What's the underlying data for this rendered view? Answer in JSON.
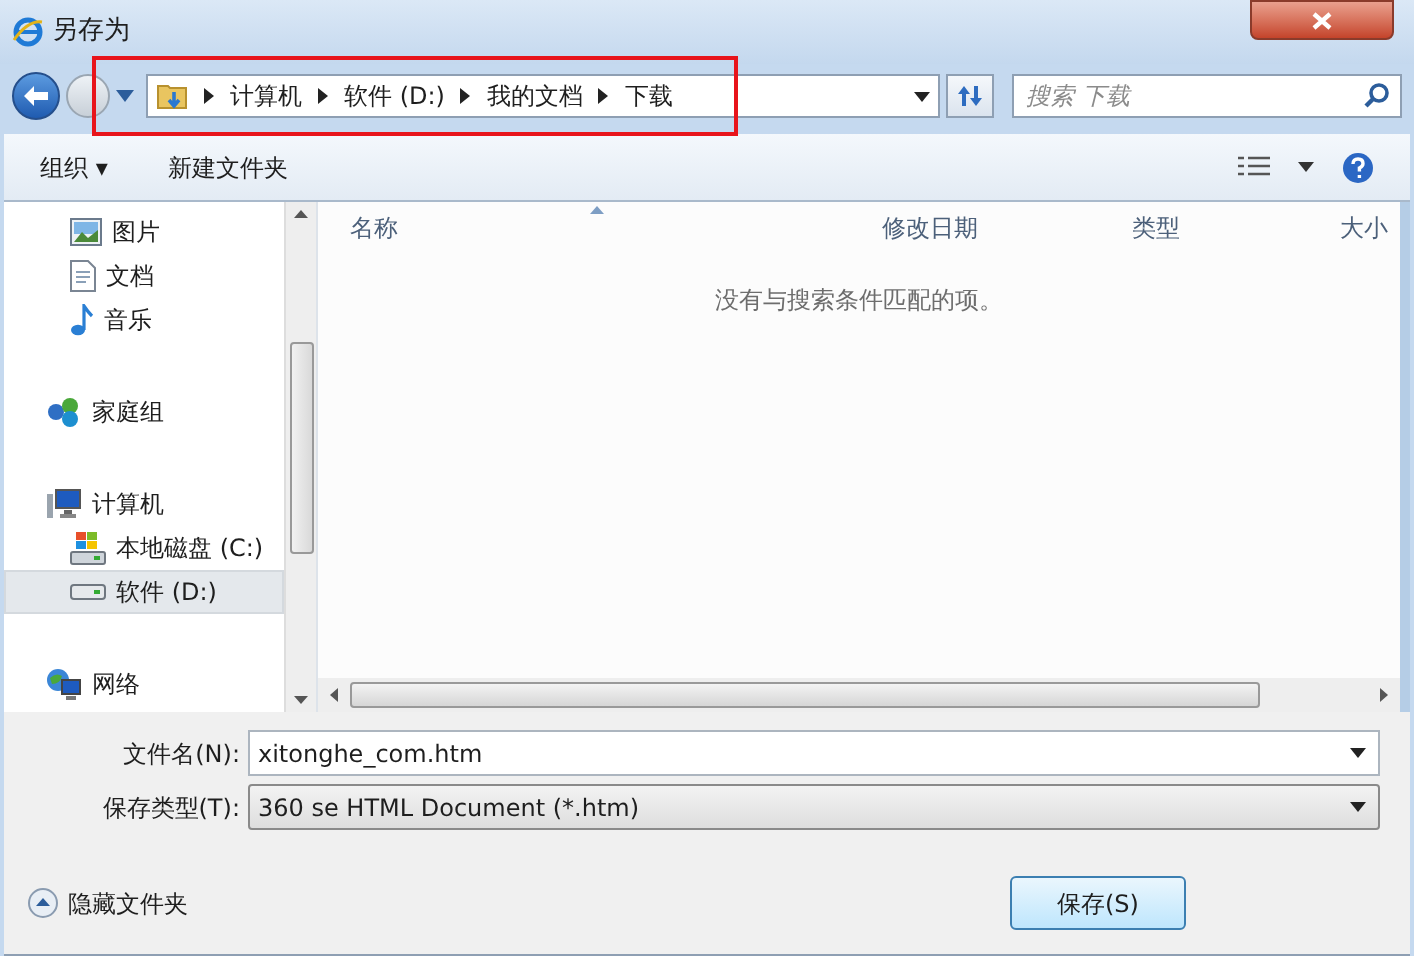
{
  "window": {
    "title": "另存为"
  },
  "breadcrumb": [
    "计算机",
    "软件 (D:)",
    "我的文档",
    "下载"
  ],
  "search": {
    "placeholder": "搜索 下载"
  },
  "toolbar": {
    "organize": "组织 ▾",
    "new_folder": "新建文件夹"
  },
  "sidebar": {
    "items": [
      {
        "label": "图片",
        "kind": "pictures",
        "group": false,
        "selected": false
      },
      {
        "label": "文档",
        "kind": "documents",
        "group": false,
        "selected": false
      },
      {
        "label": "音乐",
        "kind": "music",
        "group": false,
        "selected": false
      },
      {
        "label": "家庭组",
        "kind": "homegroup",
        "group": true,
        "selected": false
      },
      {
        "label": "计算机",
        "kind": "computer",
        "group": true,
        "selected": false
      },
      {
        "label": "本地磁盘 (C:)",
        "kind": "systemdrive",
        "group": false,
        "selected": false
      },
      {
        "label": "软件 (D:)",
        "kind": "drive",
        "group": false,
        "selected": true
      },
      {
        "label": "网络",
        "kind": "network",
        "group": true,
        "selected": false
      }
    ]
  },
  "table": {
    "columns": [
      "名称",
      "修改日期",
      "类型",
      "大小"
    ],
    "empty_message": "没有与搜索条件匹配的项。"
  },
  "form": {
    "file_name_label": "文件名(N):",
    "file_name": "xitonghe_com.htm",
    "file_type_label": "保存类型(T):",
    "file_type": "360 se HTML Document (*.htm)"
  },
  "hide_folders": "隐藏文件夹",
  "buttons": [
    "保存(S)"
  ]
}
